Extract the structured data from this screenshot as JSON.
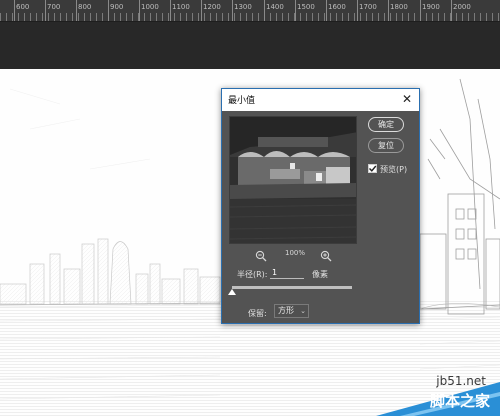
{
  "ruler": {
    "labels": [
      "600",
      "700",
      "800",
      "900",
      "1000",
      "1100",
      "1200",
      "1300",
      "1400",
      "1500",
      "1600",
      "1700",
      "1800",
      "1900",
      "2000"
    ]
  },
  "dialog": {
    "title": "最小值",
    "close_glyph": "✕",
    "ok_label": "确定",
    "reset_label": "复位",
    "preview_checked": true,
    "preview_label": "预览(P)",
    "zoom_level": "100%",
    "radius_label": "半径(R):",
    "radius_value": "1",
    "radius_unit": "像素",
    "radius_slider_fraction": 0.0,
    "preserve_label": "保留:",
    "preserve_value": "方形"
  },
  "watermark": {
    "url": "jb51.net",
    "brand": "脚本之家"
  },
  "colors": {
    "dialog_bg": "#535353",
    "dialog_border": "#2a6fb0",
    "workspace": "#282828",
    "watermark_blue": "#2a8fd6"
  },
  "icons": {
    "zoom_out": "zoom-out-icon",
    "zoom_in": "zoom-in-icon",
    "close": "close-icon",
    "checkbox": "checkmark-icon",
    "dropdown": "chevron-down-icon"
  }
}
